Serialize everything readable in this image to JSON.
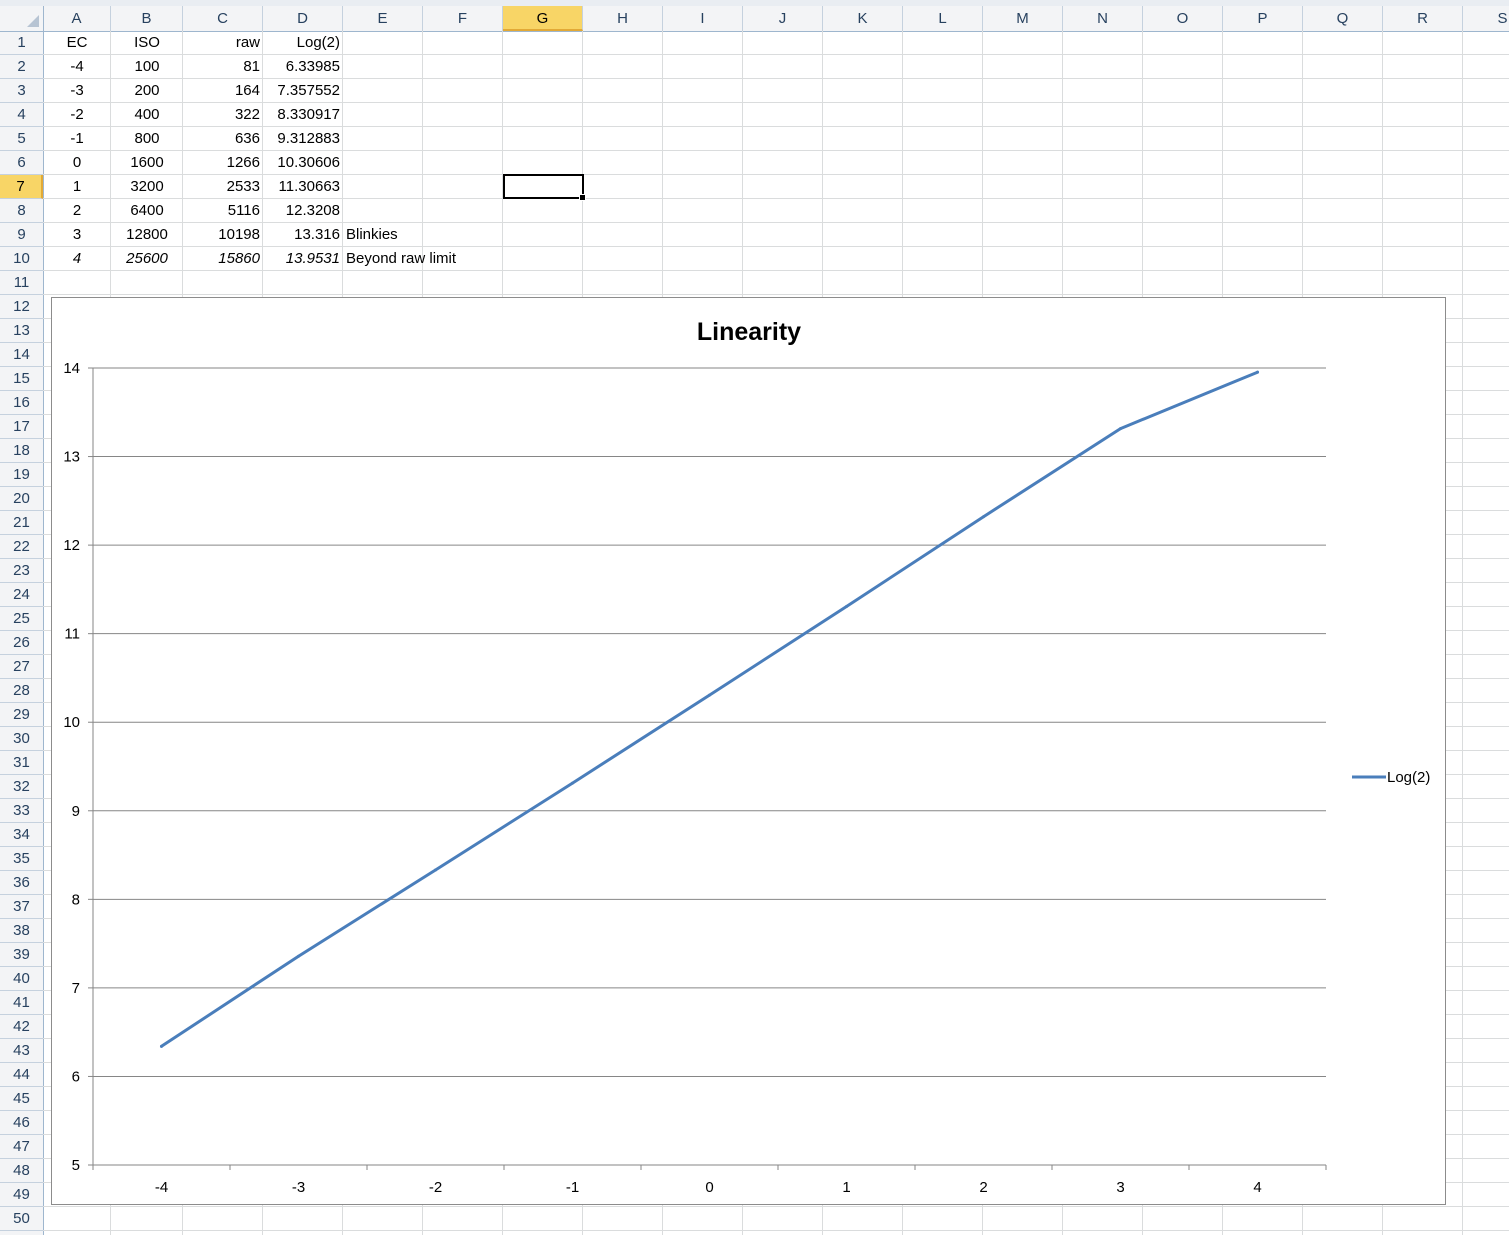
{
  "columns": [
    "A",
    "B",
    "C",
    "D",
    "E",
    "F",
    "G",
    "H",
    "I",
    "J",
    "K",
    "L",
    "M",
    "N",
    "O",
    "P",
    "Q",
    "R",
    "S"
  ],
  "selected_column": "G",
  "row_count": 50,
  "selected_row": 7,
  "cells": [
    [
      "EC",
      "ISO",
      "raw",
      "Log(2)",
      ""
    ],
    [
      "-4",
      "100",
      "81",
      "6.33985",
      ""
    ],
    [
      "-3",
      "200",
      "164",
      "7.357552",
      ""
    ],
    [
      "-2",
      "400",
      "322",
      "8.330917",
      ""
    ],
    [
      "-1",
      "800",
      "636",
      "9.312883",
      ""
    ],
    [
      "0",
      "1600",
      "1266",
      "10.30606",
      ""
    ],
    [
      "1",
      "3200",
      "2533",
      "11.30663",
      ""
    ],
    [
      "2",
      "6400",
      "5116",
      "12.3208",
      ""
    ],
    [
      "3",
      "12800",
      "10198",
      "13.316",
      "Blinkies"
    ],
    [
      "4",
      "25600",
      "15860",
      "13.9531",
      "Beyond raw limit"
    ]
  ],
  "chart_data": {
    "type": "line",
    "title": "Linearity",
    "categories": [
      "-4",
      "-3",
      "-2",
      "-1",
      "0",
      "1",
      "2",
      "3",
      "4"
    ],
    "series": [
      {
        "name": "Log(2)",
        "color": "#4a7ebb",
        "values": [
          6.33985,
          7.357552,
          8.330917,
          9.312883,
          10.30606,
          11.30663,
          12.3208,
          13.316,
          13.9531
        ]
      }
    ],
    "ylim": [
      5,
      14
    ],
    "yticks": [
      "5",
      "6",
      "7",
      "8",
      "9",
      "10",
      "11",
      "12",
      "13",
      "14"
    ],
    "grid": true,
    "legend": "right",
    "xlabel": "",
    "ylabel": ""
  }
}
